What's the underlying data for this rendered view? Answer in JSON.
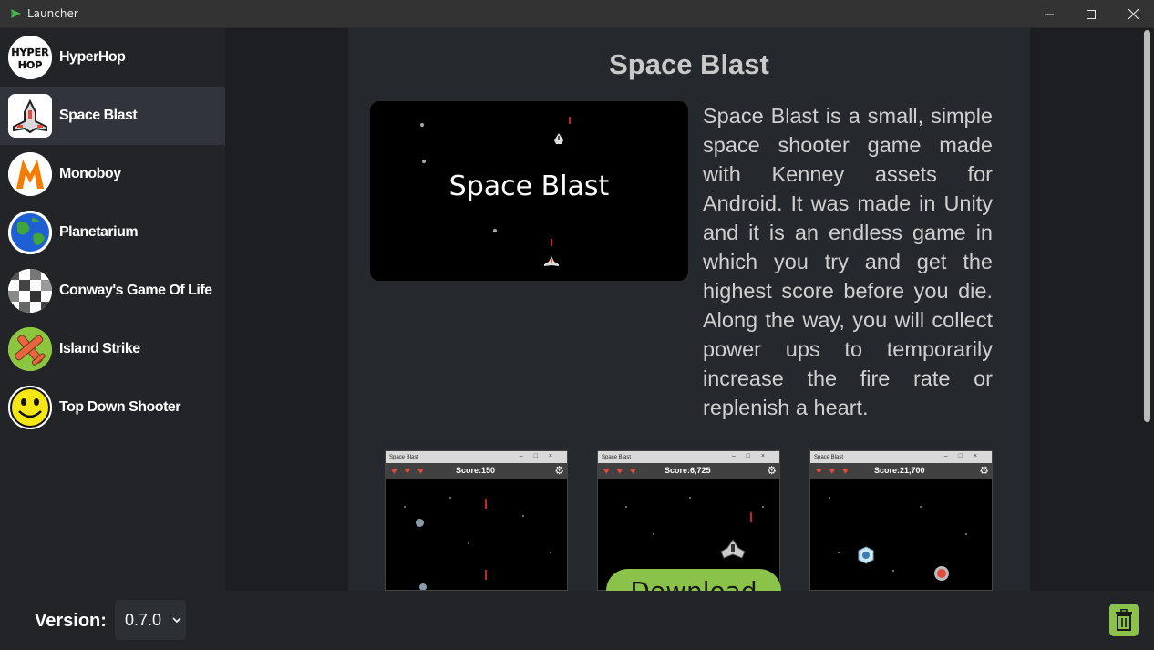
{
  "window": {
    "title": "Launcher",
    "minimize_icon": "minimize-icon",
    "maximize_icon": "maximize-icon",
    "close_icon": "close-icon"
  },
  "sidebar": {
    "items": [
      {
        "label": "HyperHop",
        "icon": "hyperhop-logo-icon"
      },
      {
        "label": "Space Blast",
        "icon": "spaceship-icon",
        "active": true
      },
      {
        "label": "Monoboy",
        "icon": "monoboy-m-icon"
      },
      {
        "label": "Planetarium",
        "icon": "planet-icon"
      },
      {
        "label": "Conway's Game Of Life",
        "icon": "grid-cells-icon"
      },
      {
        "label": "Island Strike",
        "icon": "plane-icon"
      },
      {
        "label": "Top Down Shooter",
        "icon": "smiley-icon"
      }
    ]
  },
  "game": {
    "title": "Space Blast",
    "banner_title": "Space Blast",
    "description": "Space Blast is a small, simple space shooter game made with Kenney assets for Android. It was made in Unity and it is an endless game in which you try and get the highest score before you die. Along the way, you will collect power ups to temporarily increase the fire rate or replenish a heart.",
    "screenshots": [
      {
        "window_title": "Space Blast",
        "score": "Score:150"
      },
      {
        "window_title": "Space Blast",
        "score": "Score:6,725"
      },
      {
        "window_title": "Space Blast",
        "score": "Score:21,700"
      }
    ],
    "download_label": "Download"
  },
  "footer": {
    "version_label": "Version:",
    "version_value": "0.7.0"
  },
  "colors": {
    "accent": "#8bc34a",
    "sidebar_bg": "#222428",
    "active_item_bg": "#31353b",
    "panel_bg": "#25282d"
  }
}
